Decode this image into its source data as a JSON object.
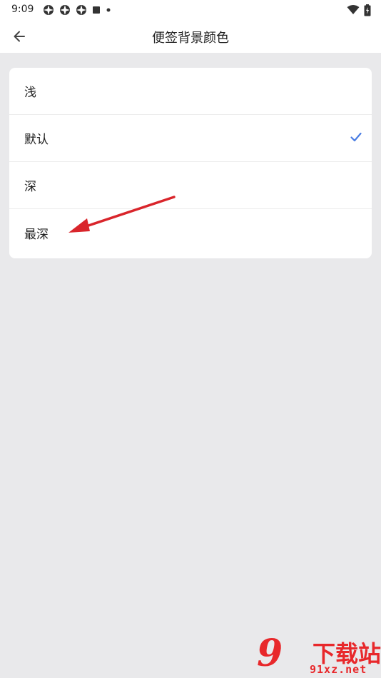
{
  "status_bar": {
    "time": "9:09",
    "left_icons": [
      "aperture-icon",
      "aperture-icon",
      "aperture-icon",
      "square-icon",
      "dot-icon"
    ],
    "right_icons": [
      "wifi-icon",
      "battery-icon"
    ]
  },
  "header": {
    "title": "便签背景颜色",
    "back_icon": "arrow-left-icon"
  },
  "options": [
    {
      "label": "浅",
      "selected": false
    },
    {
      "label": "默认",
      "selected": true
    },
    {
      "label": "深",
      "selected": false
    },
    {
      "label": "最深",
      "selected": false
    }
  ],
  "accent_color": "#4a7de3",
  "annotation_arrow_color": "#d9252b",
  "watermark": {
    "logo_text": "9",
    "brand": "下载站",
    "url": "91xz.net"
  }
}
